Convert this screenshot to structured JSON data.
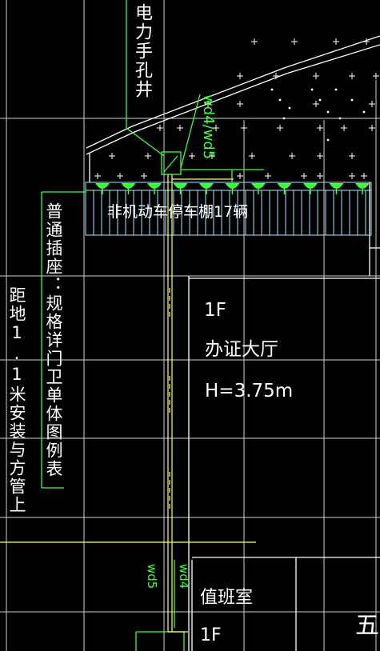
{
  "labels": {
    "power_well": "电力手孔井",
    "cable_tag_top": "wd4/wd5",
    "bike_shed": "非机动车停车棚17辆",
    "socket_note": "普通插座：规格详门卫单体图例表",
    "socket_height_note": "距地1.1米安装与方管上",
    "floor_1f": "1F",
    "hall_name": "办证大厅",
    "hall_height": "H=3.75m",
    "cable_tag_wd4": "wd4",
    "cable_tag_wd5": "wd5",
    "duty_room": "值班室",
    "floor_1f_duty": "1F",
    "edge_text": "五"
  },
  "colors": {
    "background": "#000000",
    "grid": "#d8d8d8",
    "wire_green": "#3cff3c",
    "wire_yellow": "#ffff66",
    "light_blue": "#9fe8ff",
    "text_white": "#ffffff"
  }
}
